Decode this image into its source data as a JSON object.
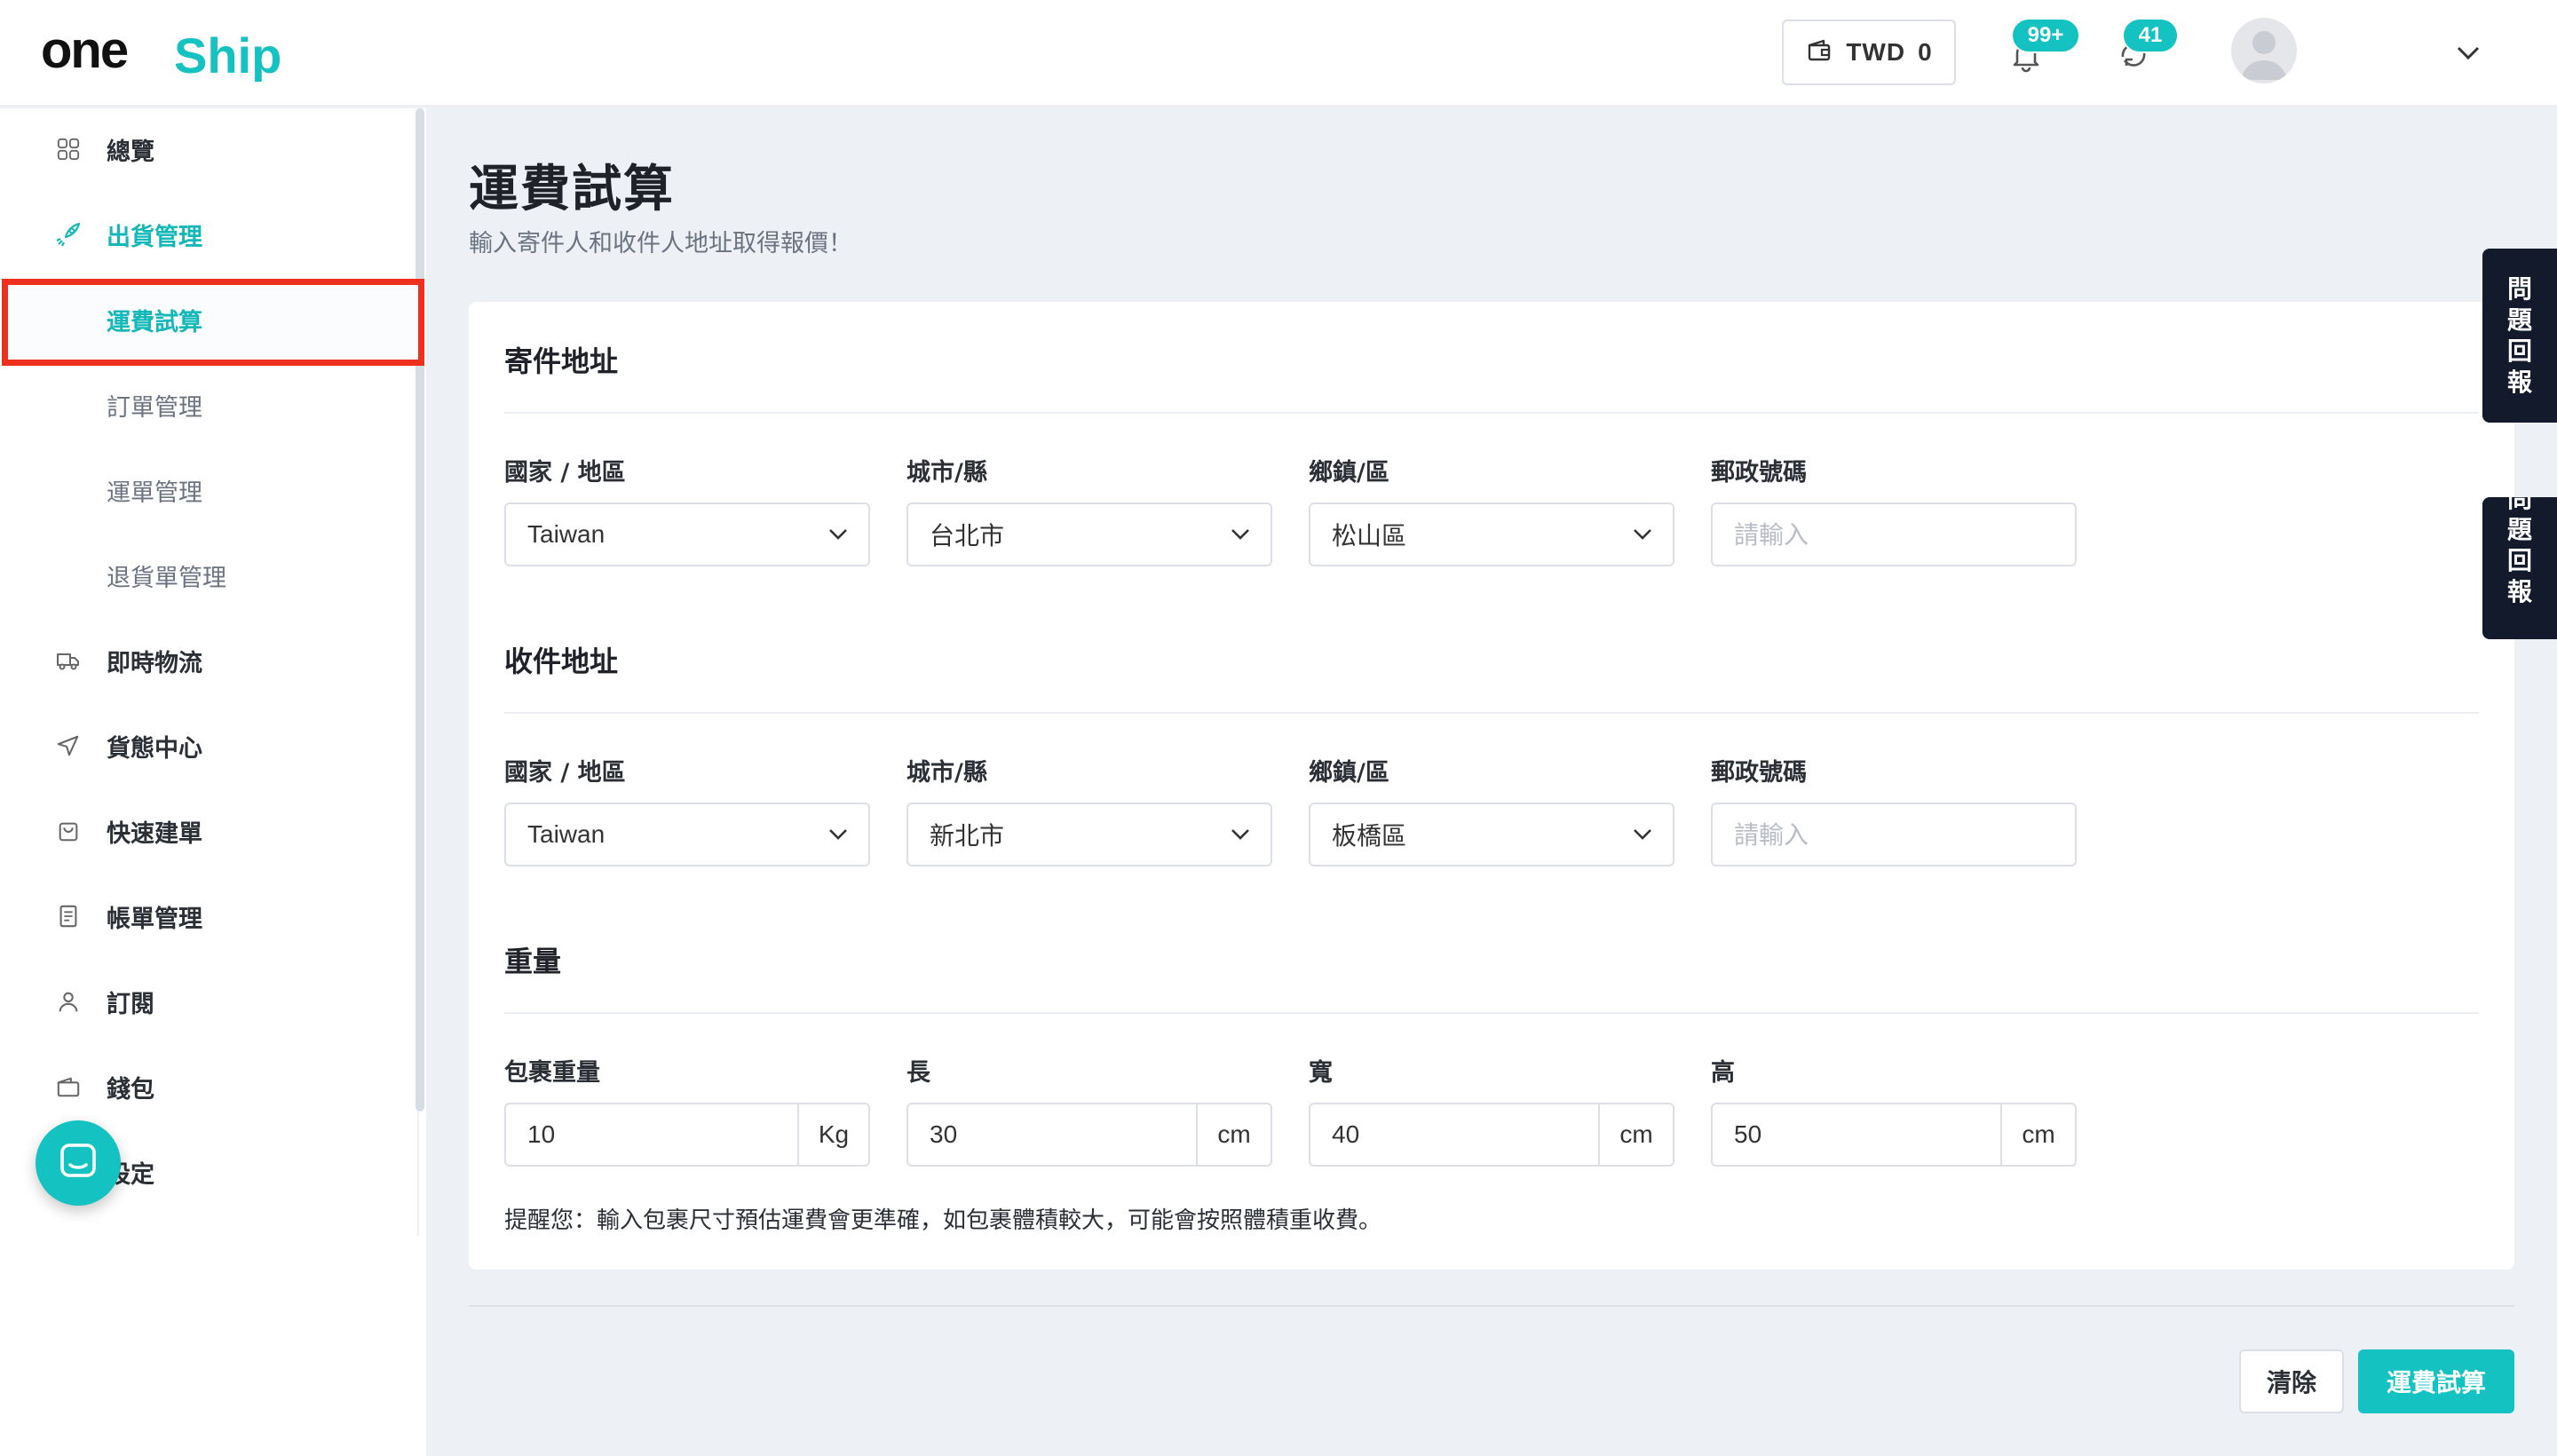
{
  "header": {
    "logo_text": "oneShip",
    "wallet": {
      "currency": "TWD",
      "amount": "0"
    },
    "notifications_badge": "99+",
    "sync_badge": "41"
  },
  "sidebar": {
    "items": [
      {
        "label": "總覽",
        "icon": "grid-icon"
      },
      {
        "label": "出貨管理",
        "icon": "rocket-icon"
      },
      {
        "label": "運費試算",
        "icon": ""
      },
      {
        "label": "訂單管理",
        "icon": ""
      },
      {
        "label": "運單管理",
        "icon": ""
      },
      {
        "label": "退貨單管理",
        "icon": ""
      },
      {
        "label": "即時物流",
        "icon": "truck-icon"
      },
      {
        "label": "貨態中心",
        "icon": "send-icon"
      },
      {
        "label": "快速建單",
        "icon": "bag-icon"
      },
      {
        "label": "帳單管理",
        "icon": "receipt-icon"
      },
      {
        "label": "訂閱",
        "icon": "user-icon"
      },
      {
        "label": "錢包",
        "icon": "wallet-icon"
      },
      {
        "label": "設定",
        "icon": "gear-icon"
      }
    ]
  },
  "page": {
    "title": "運費試算",
    "subtitle": "輸入寄件人和收件人地址取得報價！"
  },
  "sender": {
    "title": "寄件地址",
    "country_label": "國家 / 地區",
    "country_value": "Taiwan",
    "city_label": "城市/縣",
    "city_value": "台北市",
    "district_label": "鄉鎮/區",
    "district_value": "松山區",
    "postal_label": "郵政號碼",
    "postal_placeholder": "請輸入"
  },
  "receiver": {
    "title": "收件地址",
    "country_label": "國家 / 地區",
    "country_value": "Taiwan",
    "city_label": "城市/縣",
    "city_value": "新北市",
    "district_label": "鄉鎮/區",
    "district_value": "板橋區",
    "postal_label": "郵政號碼",
    "postal_placeholder": "請輸入"
  },
  "weight": {
    "title": "重量",
    "weight_label": "包裹重量",
    "weight_value": "10",
    "weight_unit": "Kg",
    "length_label": "長",
    "length_value": "30",
    "width_label": "寬",
    "width_value": "40",
    "height_label": "高",
    "height_value": "50",
    "dim_unit": "cm",
    "hint": "提醒您：輸入包裹尺寸預估運費會更準確，如包裹體積較大，可能會按照體積重收費。"
  },
  "actions": {
    "clear_label": "清除",
    "calculate_label": "運費試算"
  },
  "feedback": {
    "chars": [
      "問",
      "題",
      "回",
      "報"
    ]
  },
  "colors": {
    "accent": "#14c2c2",
    "highlight_box": "#f0301e",
    "feedback_bg": "#121a2b"
  }
}
